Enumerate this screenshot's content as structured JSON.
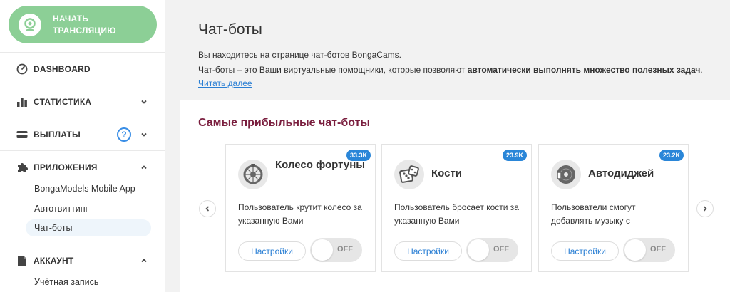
{
  "sidebar": {
    "stream_button": "НАЧАТЬ ТРАНСЛЯЦИЮ",
    "items": [
      {
        "label": "DASHBOARD",
        "icon": "gauge-icon"
      },
      {
        "label": "СТАТИСТИКА",
        "icon": "bar-chart-icon"
      },
      {
        "label": "ВЫПЛАТЫ",
        "icon": "wallet-icon",
        "help": "?"
      },
      {
        "label": "ПРИЛОЖЕНИЯ",
        "icon": "puzzle-icon"
      },
      {
        "label": "АККАУНТ",
        "icon": "document-icon"
      }
    ],
    "apps_sub": [
      "BongaModels Mobile App",
      "Автотвиттинг",
      "Чат-боты"
    ],
    "account_sub": [
      "Учётная запись"
    ]
  },
  "main": {
    "title": "Чат-боты",
    "intro_line1": "Вы находитесь на странице чат-ботов BongaCams.",
    "intro_line2_plain": "Чат-боты – это Ваши виртуальные помощники, которые позволяют ",
    "intro_line2_bold": "автоматически выполнять множество полезных задач",
    "intro_line2_end": ".",
    "read_more": "Читать далее",
    "section_title": "Самые прибыльные чат-боты"
  },
  "bots": [
    {
      "name": "Колесо фортуны",
      "badge": "33.3K",
      "description": "Пользователь крутит колесо за указанную Вами",
      "settings_label": "Настройки",
      "toggle_label": "OFF",
      "icon": "fortune-wheel-icon"
    },
    {
      "name": "Кости",
      "badge": "23.9K",
      "description": "Пользователь бросает кости за указанную Вами",
      "settings_label": "Настройки",
      "toggle_label": "OFF",
      "icon": "dice-icon"
    },
    {
      "name": "Автодиджей",
      "badge": "23.2K",
      "description": "Пользователи смогут добавлять музыку с",
      "settings_label": "Настройки",
      "toggle_label": "OFF",
      "icon": "vinyl-icon"
    }
  ],
  "colors": {
    "stream_button": "#8ccf96",
    "accent_blue": "#2a86d8",
    "section_title": "#7a1e3e"
  }
}
